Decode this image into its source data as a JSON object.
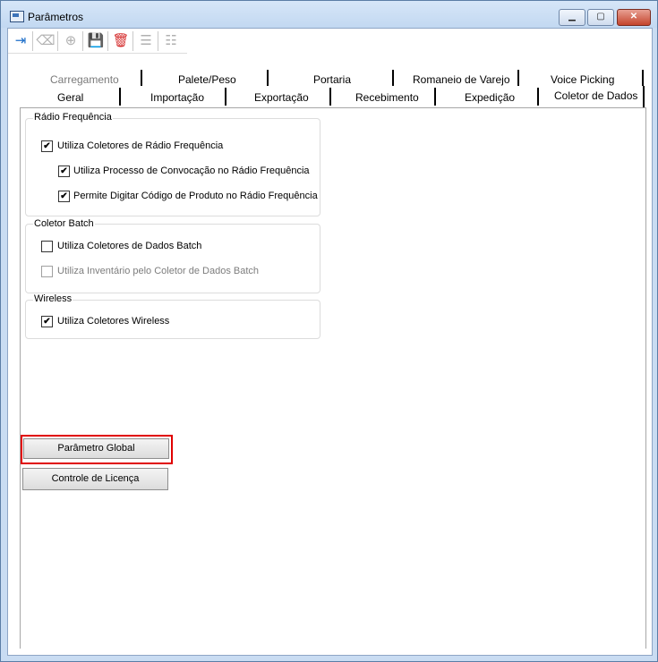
{
  "window": {
    "title": "Parâmetros",
    "controls": {
      "minimize": "▁",
      "maximize": "▢",
      "close": "✕"
    }
  },
  "toolbar": {
    "items": [
      {
        "name": "exit-icon",
        "glyph": "⇥",
        "color": "#1d6ec9"
      },
      {
        "name": "eraser-icon",
        "glyph": "⌫",
        "color": "#b0b0b0"
      },
      {
        "name": "add-circle-icon",
        "glyph": "⊕",
        "color": "#b0b0b0"
      },
      {
        "name": "save-icon",
        "glyph": "💾",
        "color": "#1d6ec9"
      },
      {
        "name": "delete-icon",
        "glyph": "🗑",
        "color": "#d42a2a"
      },
      {
        "name": "add-row-icon",
        "glyph": "☰",
        "color": "#b0b0b0"
      },
      {
        "name": "remove-row-icon",
        "glyph": "☷",
        "color": "#b0b0b0"
      }
    ]
  },
  "tabs": {
    "row1": [
      "Carregamento",
      "Palete/Peso",
      "Portaria",
      "Romaneio de Varejo",
      "Voice Picking"
    ],
    "row2": [
      "Geral",
      "Importação",
      "Exportação",
      "Recebimento",
      "Expedição",
      "Coletor de Dados"
    ],
    "active": "Coletor de Dados"
  },
  "groups": {
    "radio": {
      "label": "Rádio Frequência",
      "items": [
        {
          "label": "Utiliza Coletores de Rádio Frequência",
          "checked": true,
          "enabled": true
        },
        {
          "label": "Utiliza Processo de Convocação no Rádio Frequência",
          "checked": true,
          "enabled": true
        },
        {
          "label": "Permite Digitar Código de Produto no Rádio Frequência",
          "checked": true,
          "enabled": true
        }
      ]
    },
    "batch": {
      "label": "Coletor Batch",
      "items": [
        {
          "label": "Utiliza Coletores de Dados Batch",
          "checked": false,
          "enabled": true
        },
        {
          "label": "Utiliza Inventário pelo Coletor de Dados Batch",
          "checked": false,
          "enabled": false
        }
      ]
    },
    "wireless": {
      "label": "Wireless",
      "items": [
        {
          "label": "Utiliza Coletores Wireless",
          "checked": true,
          "enabled": true
        }
      ]
    }
  },
  "buttons": {
    "global": "Parâmetro Global",
    "license": "Controle de Licença"
  },
  "colors": {
    "highlight": "#e00000"
  }
}
